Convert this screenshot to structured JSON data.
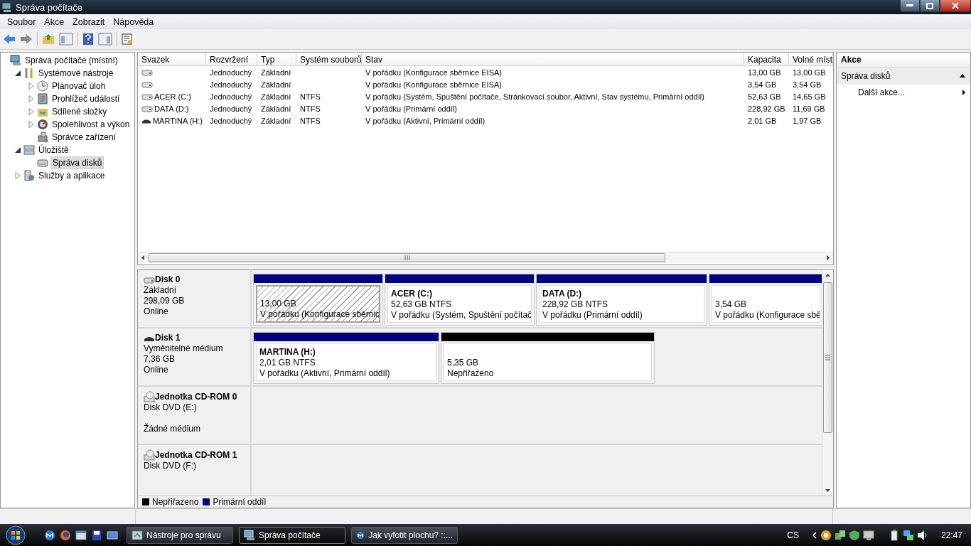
{
  "window": {
    "title": "Správa počítače"
  },
  "menu": [
    "Soubor",
    "Akce",
    "Zobrazit",
    "Nápověda"
  ],
  "tree": [
    {
      "label": "Správa počítače (místní)",
      "selected": false,
      "children": [
        {
          "label": "Systémové nástroje",
          "expanded": true,
          "selected": false,
          "children": [
            {
              "label": "Plánovač úloh",
              "expanded": false,
              "selected": false
            },
            {
              "label": "Prohlížeč událostí",
              "expanded": false,
              "selected": false
            },
            {
              "label": "Sdílené složky",
              "expanded": false,
              "selected": false
            },
            {
              "label": "Spolehlivost a výkon",
              "expanded": false,
              "selected": false
            },
            {
              "label": "Správce zařízení",
              "selected": false
            }
          ]
        },
        {
          "label": "Úložiště",
          "expanded": true,
          "selected": false,
          "children": [
            {
              "label": "Správa disků",
              "selected": true
            }
          ]
        },
        {
          "label": "Služby a aplikace",
          "expanded": false,
          "selected": false
        }
      ]
    }
  ],
  "volumes": {
    "columns": [
      "Svazek",
      "Rozvržení",
      "Typ",
      "Systém souborů",
      "Stav",
      "Kapacita",
      "Volné míst"
    ],
    "rows": [
      {
        "kind": "fixed",
        "cells": [
          "",
          "Jednoduchý",
          "Základní",
          "",
          "V pořádku (Konfigurace sběrnice EISA)",
          "13,00 GB",
          "13,00 GB"
        ]
      },
      {
        "kind": "fixed",
        "cells": [
          "",
          "Jednoduchý",
          "Základní",
          "",
          "V pořádku (Konfigurace sběrnice EISA)",
          "3,54 GB",
          "3,54 GB"
        ]
      },
      {
        "kind": "fixed",
        "cells": [
          "ACER (C:)",
          "Jednoduchý",
          "Základní",
          "NTFS",
          "V pořádku (Systém, Spuštění počítače, Stránkovací soubor, Aktivní, Stav systému, Primární oddíl)",
          "52,63 GB",
          "14,65 GB"
        ]
      },
      {
        "kind": "fixed",
        "cells": [
          "DATA (D:)",
          "Jednoduchý",
          "Základní",
          "NTFS",
          "V pořádku (Primární oddíl)",
          "228,92 GB",
          "11,69 GB"
        ]
      },
      {
        "kind": "removable",
        "cells": [
          "MARTINA (H:)",
          "Jednoduchý",
          "Základní",
          "NTFS",
          "V pořádku (Aktivní, Primární oddíl)",
          "2,01 GB",
          "1,97 GB"
        ]
      }
    ]
  },
  "disks": [
    {
      "kind": "fixed",
      "name": "Disk 0",
      "type": "Základní",
      "size": "298,09 GB",
      "state": "Online",
      "partitions": [
        {
          "kind": "primary",
          "selected": true,
          "size": "13,00 GB",
          "status": "V pořádku (Konfigurace sběrnic"
        },
        {
          "kind": "primary",
          "selected": false,
          "name": "ACER  (C:)",
          "size": "52,63 GB NTFS",
          "status": "V pořádku (Systém, Spuštění počítač"
        },
        {
          "kind": "primary",
          "selected": false,
          "name": "DATA  (D:)",
          "size": "228,92 GB NTFS",
          "status": "V pořádku (Primární oddíl)"
        },
        {
          "kind": "primary",
          "selected": false,
          "size": "3,54 GB",
          "status": "V pořádku (Konfigurace sbě"
        }
      ]
    },
    {
      "kind": "removable",
      "name": "Disk 1",
      "type": "Vyměnitelné médium",
      "size": "7,36 GB",
      "state": "Online",
      "partitions": [
        {
          "kind": "primary",
          "selected": false,
          "name": "MARTINA  (H:)",
          "size": "2,01 GB NTFS",
          "status": "V pořádku (Aktivní, Primární oddíl)"
        },
        {
          "kind": "unallocated",
          "selected": false,
          "size": "5,35 GB",
          "status": "Nepřiřazeno"
        }
      ]
    },
    {
      "kind": "cdrom",
      "name": "Jednotka CD-ROM 0",
      "type": "Disk DVD (E:)",
      "state": "Žádné médium"
    },
    {
      "kind": "cdrom",
      "name": "Jednotka CD-ROM 1",
      "type": "Disk DVD (F:)"
    }
  ],
  "legend": [
    {
      "label": "Nepřiřazeno",
      "color": "#000000"
    },
    {
      "label": "Primární oddíl",
      "color": "#000080"
    }
  ],
  "actions": {
    "title": "Akce",
    "section": {
      "label": "Správa disků",
      "expanded": true
    },
    "items": [
      "Další akce..."
    ]
  },
  "taskbar": {
    "tasks": [
      {
        "label": "Nástroje pro správu",
        "selected": false
      },
      {
        "label": "Správa počítače",
        "selected": true
      },
      {
        "label": "Jak vyfotit plochu? ::...",
        "selected": false
      }
    ],
    "language": "CS",
    "time": "22:47"
  }
}
